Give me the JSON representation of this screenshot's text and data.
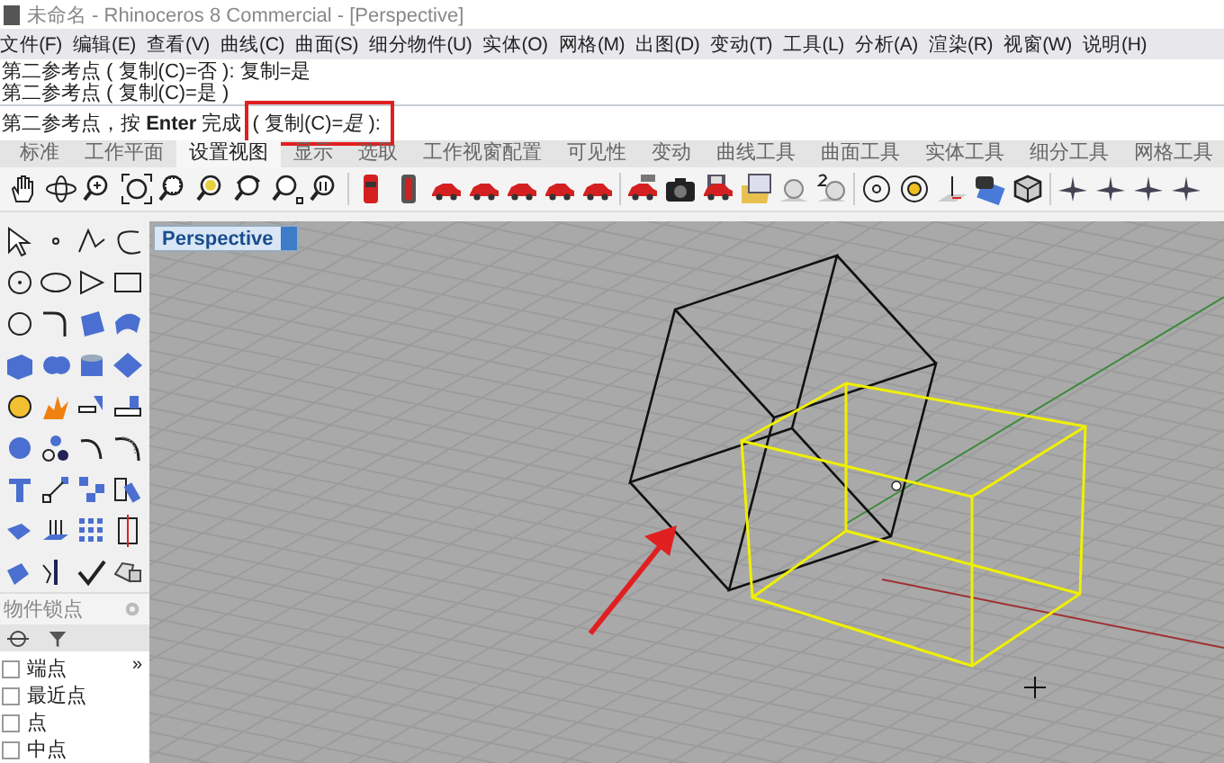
{
  "window": {
    "title": "未命名 - Rhinoceros 8 Commercial - [Perspective]"
  },
  "menu": [
    "文件(F)",
    "编辑(E)",
    "查看(V)",
    "曲线(C)",
    "曲面(S)",
    "细分物件(U)",
    "实体(O)",
    "网格(M)",
    "出图(D)",
    "变动(T)",
    "工具(L)",
    "分析(A)",
    "渲染(R)",
    "视窗(W)",
    "说明(H)"
  ],
  "command_history": [
    "第二参考点 ( 复制(C)=否 ): 复制=是",
    "第二参考点 ( 复制(C)=是 )"
  ],
  "command_prompt": {
    "text": "第二参考点，按 **Enter** 完成",
    "option": "( 复制(C)=*是* ):"
  },
  "toolbar_tabs": [
    {
      "label": "标准",
      "selected": false
    },
    {
      "label": "工作平面",
      "selected": false
    },
    {
      "label": "设置视图",
      "selected": true
    },
    {
      "label": "显示",
      "selected": false
    },
    {
      "label": "选取",
      "selected": false
    },
    {
      "label": "工作视窗配置",
      "selected": false
    },
    {
      "label": "可见性",
      "selected": false
    },
    {
      "label": "变动",
      "selected": false
    },
    {
      "label": "曲线工具",
      "selected": false
    },
    {
      "label": "曲面工具",
      "selected": false
    },
    {
      "label": "实体工具",
      "selected": false
    },
    {
      "label": "细分工具",
      "selected": false
    },
    {
      "label": "网格工具",
      "selected": false
    }
  ],
  "osnap_panel": {
    "title": "物件锁点",
    "more": "»",
    "items": [
      {
        "label": "端点",
        "checked": false
      },
      {
        "label": "最近点",
        "checked": false
      },
      {
        "label": "点",
        "checked": false
      },
      {
        "label": "中点",
        "checked": false
      }
    ]
  },
  "viewport": {
    "title": "Perspective"
  }
}
